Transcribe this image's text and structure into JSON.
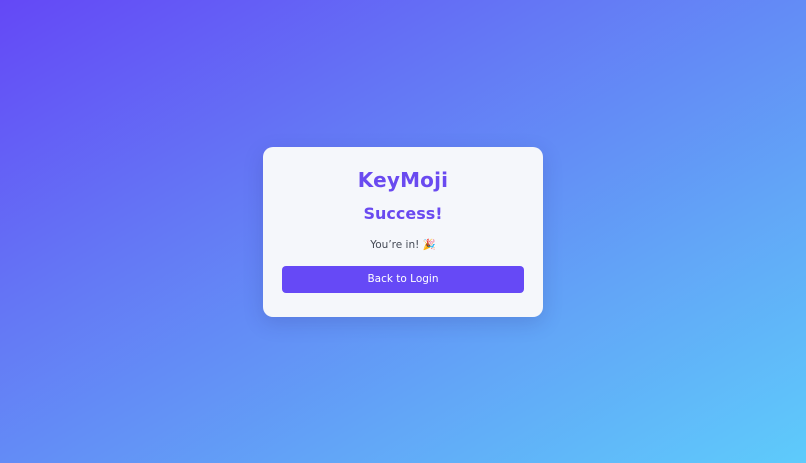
{
  "card": {
    "brand": "KeyMoji",
    "title": "Success!",
    "message": "You’re in! 🎉",
    "button_label": "Back to Login"
  },
  "colors": {
    "accent": "#6649f6",
    "brand_text": "#6a4af0",
    "card_bg": "#f5f7fb",
    "gradient_start": "#6448f6",
    "gradient_end": "#5ecbfb"
  }
}
